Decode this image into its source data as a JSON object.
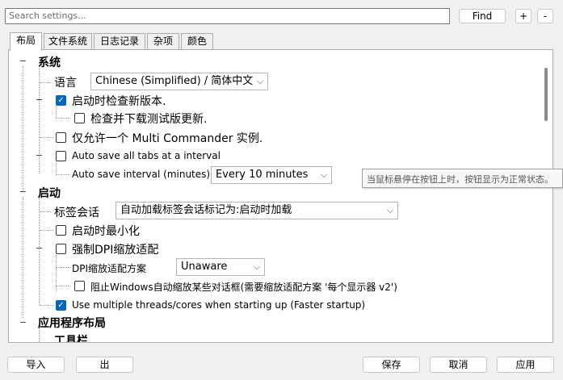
{
  "search": {
    "placeholder": "Search settings..."
  },
  "toolbar": {
    "find_label": "Find",
    "expand_label": "+",
    "collapse_label": "-"
  },
  "tabs": [
    {
      "label": "布局",
      "active": true
    },
    {
      "label": "文件系统"
    },
    {
      "label": "日志记录"
    },
    {
      "label": "杂项"
    },
    {
      "label": "颜色"
    }
  ],
  "tree": {
    "system": {
      "section": "系统",
      "language_label": "语言",
      "language_value": "Chinese (Simplified) / 简体中文",
      "check_update": "启动时检查新版本.",
      "check_beta": "检查并下载测试版更新.",
      "single_instance": "仅允许一个 Multi Commander 实例.",
      "autosave": "Auto save all tabs at a interval",
      "autosave_interval_label": "Auto save interval (minutes)",
      "autosave_interval_value": "Every 10 minutes"
    },
    "startup": {
      "section": "启动",
      "session_label": "标签会话",
      "session_value": "自动加载标签会话标记为:启动时加载",
      "minimize": "启动时最小化",
      "force_dpi": "强制DPI缩放适配",
      "dpi_label": "DPI缩放适配方案",
      "dpi_value": "Unaware",
      "block_windows": "阻止Windows自动缩放某些对话框(需要缩放适配方案 '每个显示器 v2')",
      "multithread": "Use multiple threads/cores when starting up (Faster startup)"
    },
    "layout": {
      "section": "应用程序布局",
      "toolbar_item": "工具栏"
    }
  },
  "checkbox_states": {
    "check_update": true,
    "check_beta": false,
    "single_instance": false,
    "autosave": false,
    "minimize": false,
    "force_dpi": false,
    "block_windows": false,
    "multithread": true
  },
  "tooltip": "当鼠标悬停在按钮上时，按钮显示为正常状态。",
  "footer": {
    "import": "导入",
    "export": "出",
    "save": "保存",
    "cancel": "取消",
    "apply": "应用"
  },
  "colors": {
    "accent": "#0067c0"
  }
}
